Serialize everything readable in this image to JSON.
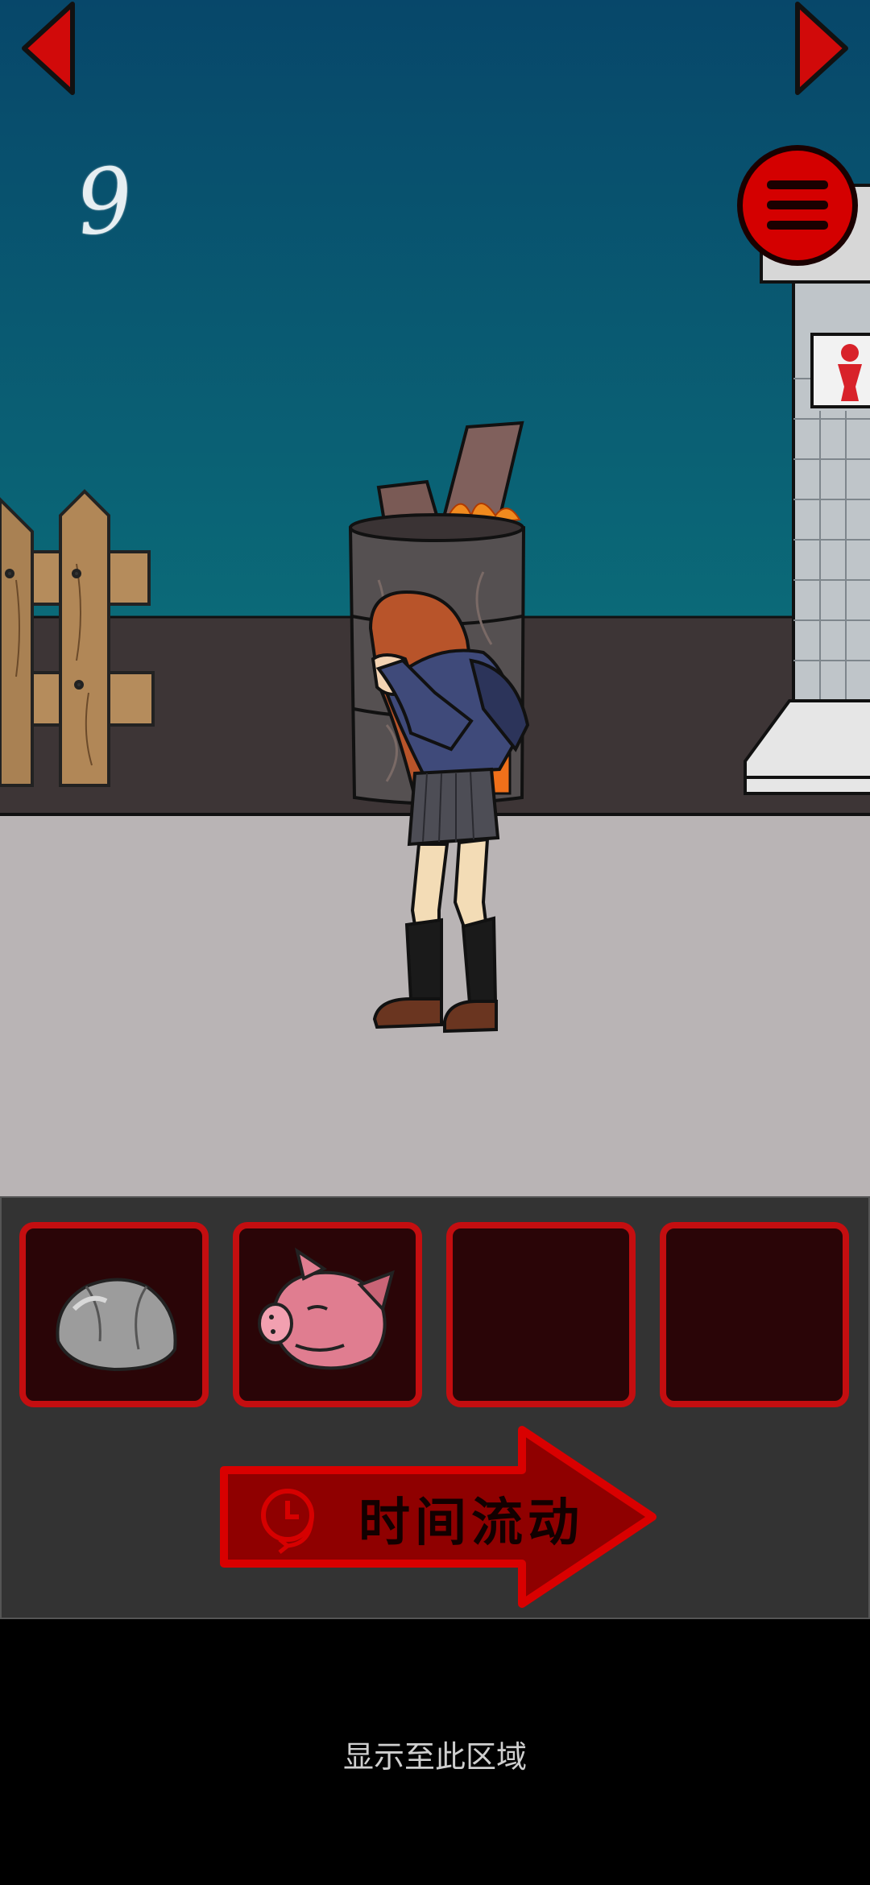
{
  "hud": {
    "counter": "9",
    "menu_icon": "hamburger-menu-icon"
  },
  "navigation": {
    "left_icon": "arrow-left-icon",
    "right_icon": "arrow-right-icon"
  },
  "inventory": {
    "slots": [
      {
        "item": "rock"
      },
      {
        "item": "pig-head"
      },
      {
        "item": ""
      },
      {
        "item": ""
      }
    ],
    "action_button": {
      "label": "时间流动",
      "icon": "clock-icon"
    }
  },
  "footer": {
    "hint": "显示至此区域"
  },
  "colors": {
    "sky_top": "#07476a",
    "sky_bottom": "#0b6a78",
    "accent_red": "#d40000",
    "inventory_bg": "#333333",
    "slot_bg": "#2a0507"
  }
}
